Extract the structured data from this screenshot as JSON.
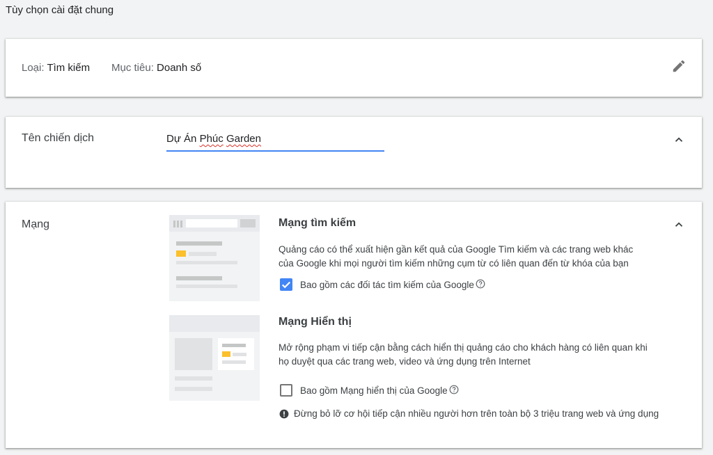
{
  "page": {
    "title": "Tùy chọn cài đặt chung"
  },
  "summary": {
    "type_label": "Loại:",
    "type_value": "Tìm kiếm",
    "goal_label": "Mục tiêu:",
    "goal_value": "Doanh số",
    "edit_icon": "pencil-icon"
  },
  "campaign_name": {
    "label": "Tên chiến dịch",
    "value_part1": "Dự Án ",
    "value_part2": "Phúc",
    "value_part3": " ",
    "value_part4": "Garden",
    "value": "Dự Án Phúc Garden"
  },
  "network": {
    "label": "Mạng",
    "search": {
      "title": "Mạng tìm kiếm",
      "description": "Quảng cáo có thể xuất hiện gần kết quả của Google Tìm kiếm và các trang web khác của Google khi mọi người tìm kiếm những cụm từ có liên quan đến từ khóa của bạn",
      "checkbox_label": "Bao gồm các đối tác tìm kiếm của Google",
      "checked": true
    },
    "display": {
      "title": "Mạng Hiển thị",
      "description": "Mở rộng phạm vi tiếp cận bằng cách hiển thị quảng cáo cho khách hàng có liên quan khi họ duyệt qua các trang web, video và ứng dụng trên Internet",
      "checkbox_label": "Bao gồm Mạng hiển thị của Google",
      "checked": false,
      "warning": "Đừng bỏ lỡ cơ hội tiếp cận nhiều người hơn trên toàn bộ 3 triệu trang web và ứng dụng"
    }
  },
  "colors": {
    "accent": "#4285f4",
    "ad_highlight": "#fbc02d",
    "placeholder_gray": "#dadce0"
  }
}
